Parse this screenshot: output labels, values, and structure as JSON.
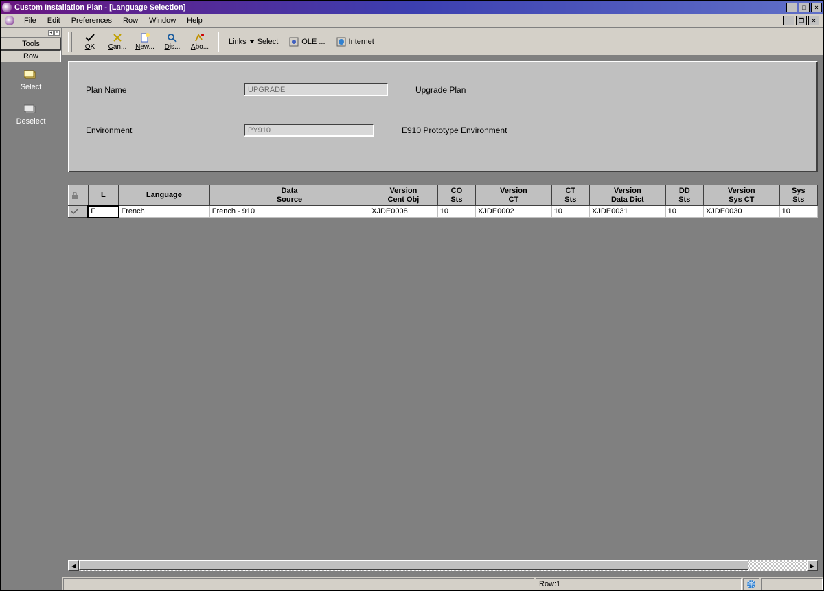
{
  "window": {
    "title": "Custom Installation Plan - [Language Selection]"
  },
  "menu": {
    "file": "File",
    "edit": "Edit",
    "preferences": "Preferences",
    "row": "Row",
    "window": "Window",
    "help": "Help"
  },
  "sidebar": {
    "tabs": {
      "tools": "Tools",
      "row": "Row"
    },
    "actions": {
      "select": "Select",
      "deselect": "Deselect"
    }
  },
  "toolbar": {
    "ok": "OK",
    "cancel": "Can...",
    "new": "New...",
    "display": "Dis...",
    "about": "Abo...",
    "links": "Links",
    "select": "Select",
    "ole": "OLE ...",
    "internet": "Internet"
  },
  "form": {
    "plan_label": "Plan Name",
    "plan_value": "UPGRADE",
    "plan_desc": "Upgrade Plan",
    "env_label": "Environment",
    "env_value": "PY910",
    "env_desc": "E910 Prototype Environment"
  },
  "grid": {
    "headers": {
      "lock": "",
      "l": "L",
      "language": "Language",
      "data_source": "Data\nSource",
      "version_cent": "Version\nCent Obj",
      "co_sts": "CO\nSts",
      "version_ct": "Version\nCT",
      "ct_sts": "CT\nSts",
      "version_dd": "Version\nData Dict",
      "dd_sts": "DD\nSts",
      "version_sys": "Version\nSys CT",
      "sys_sts": "Sys\nSts"
    },
    "rows": [
      {
        "l": "F",
        "language": "French",
        "data_source": "French - 910",
        "version_cent": "XJDE0008",
        "co_sts": "10",
        "version_ct": "XJDE0002",
        "ct_sts": "10",
        "version_dd": "XJDE0031",
        "dd_sts": "10",
        "version_sys": "XJDE0030",
        "sys_sts": "10"
      }
    ]
  },
  "status": {
    "row": "Row:1"
  }
}
